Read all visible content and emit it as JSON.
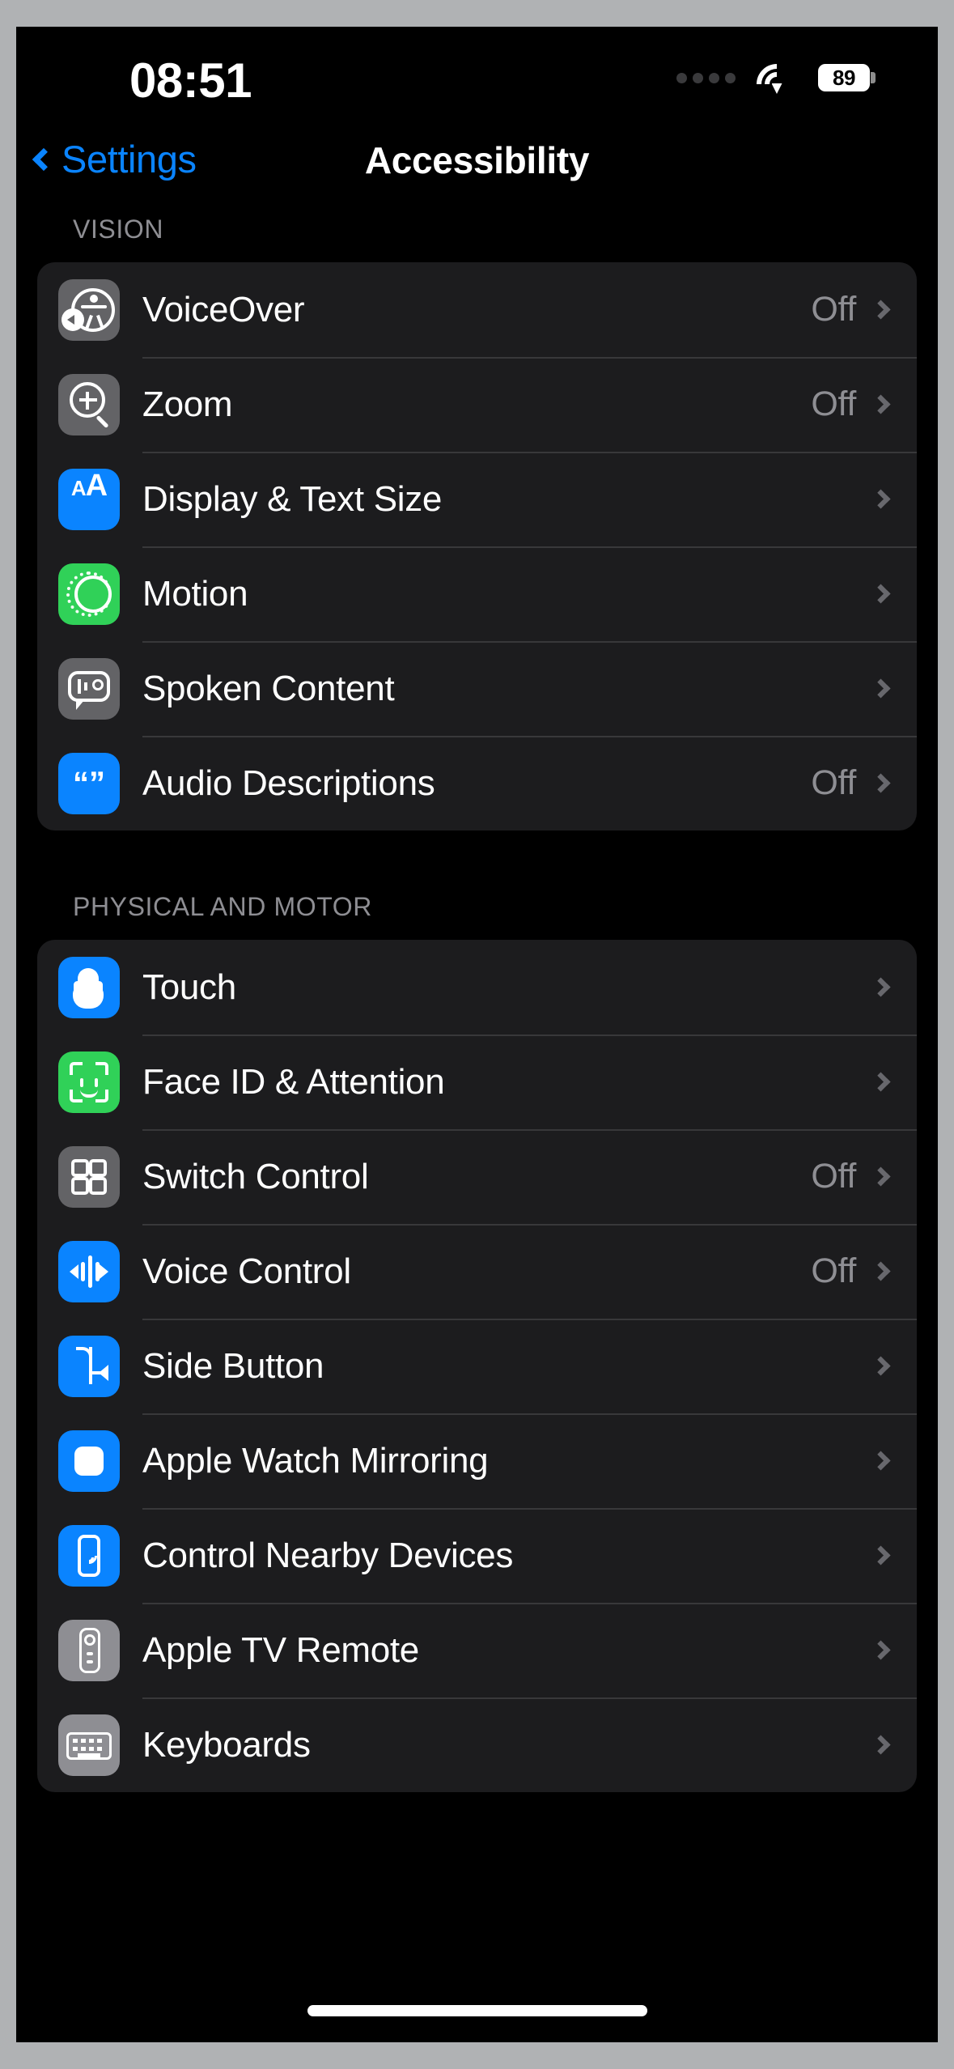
{
  "status_bar": {
    "time": "08:51",
    "battery_level": "89",
    "cellular_icon": "cellular-dots-icon",
    "wifi_icon": "wifi-icon",
    "battery_icon": "battery-icon"
  },
  "nav": {
    "back_label": "Settings",
    "title": "Accessibility",
    "back_chevron_icon": "chevron-left-icon",
    "accent_color": "#0a84ff"
  },
  "sections": [
    {
      "header": "VISION",
      "rows": [
        {
          "label": "VoiceOver",
          "value": "Off",
          "icon": "voiceover-icon",
          "icon_color": "#636366"
        },
        {
          "label": "Zoom",
          "value": "Off",
          "icon": "zoom-magnifier-icon",
          "icon_color": "#636366"
        },
        {
          "label": "Display & Text Size",
          "value": "",
          "icon": "display-text-size-icon",
          "icon_color": "#0a84ff"
        },
        {
          "label": "Motion",
          "value": "",
          "icon": "motion-icon",
          "icon_color": "#30d158"
        },
        {
          "label": "Spoken Content",
          "value": "",
          "icon": "spoken-content-icon",
          "icon_color": "#636366"
        },
        {
          "label": "Audio Descriptions",
          "value": "Off",
          "icon": "audio-descriptions-icon",
          "icon_color": "#0a84ff"
        }
      ]
    },
    {
      "header": "PHYSICAL AND MOTOR",
      "rows": [
        {
          "label": "Touch",
          "value": "",
          "icon": "touch-hand-icon",
          "icon_color": "#0a84ff"
        },
        {
          "label": "Face ID & Attention",
          "value": "",
          "icon": "face-id-icon",
          "icon_color": "#30d158"
        },
        {
          "label": "Switch Control",
          "value": "Off",
          "icon": "switch-control-icon",
          "icon_color": "#636366"
        },
        {
          "label": "Voice Control",
          "value": "Off",
          "icon": "voice-control-icon",
          "icon_color": "#0a84ff"
        },
        {
          "label": "Side Button",
          "value": "",
          "icon": "side-button-icon",
          "icon_color": "#0a84ff"
        },
        {
          "label": "Apple Watch Mirroring",
          "value": "",
          "icon": "apple-watch-mirroring-icon",
          "icon_color": "#0a84ff"
        },
        {
          "label": "Control Nearby Devices",
          "value": "",
          "icon": "control-nearby-devices-icon",
          "icon_color": "#0a84ff"
        },
        {
          "label": "Apple TV Remote",
          "value": "",
          "icon": "apple-tv-remote-icon",
          "icon_color": "#8e8e93"
        },
        {
          "label": "Keyboards",
          "value": "",
          "icon": "keyboard-icon",
          "icon_color": "#8e8e93"
        }
      ]
    }
  ],
  "colors": {
    "background": "#000000",
    "card": "#1c1c1e",
    "separator": "#38383a",
    "secondary_text": "#8e8e93",
    "blue": "#0a84ff",
    "green": "#30d158",
    "gray": "#636366"
  }
}
